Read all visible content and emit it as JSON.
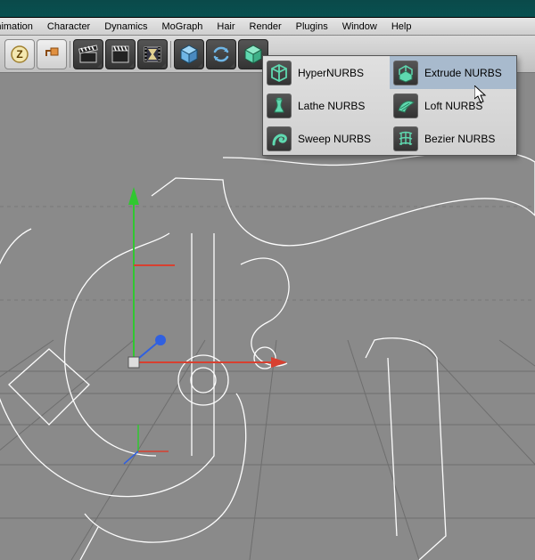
{
  "menu": {
    "items": [
      "Animation",
      "Character",
      "Dynamics",
      "MoGraph",
      "Hair",
      "Render",
      "Plugins",
      "Window",
      "Help"
    ]
  },
  "toolbar": {
    "buttons": [
      "undo",
      "redo",
      "clapper-1",
      "clapper-2",
      "render-film",
      "cube-primitive",
      "rotate-arrows",
      "nurbs-active"
    ]
  },
  "dropdown": {
    "items": [
      {
        "label": "HyperNURBS",
        "icon": "cube-wire",
        "hi": false
      },
      {
        "label": "Extrude NURBS",
        "icon": "extrude",
        "hi": true
      },
      {
        "label": "Lathe NURBS",
        "icon": "vase",
        "hi": false
      },
      {
        "label": "Loft NURBS",
        "icon": "wing",
        "hi": false
      },
      {
        "label": "Sweep NURBS",
        "icon": "swirl",
        "hi": false
      },
      {
        "label": "Bezier NURBS",
        "icon": "grid-curve",
        "hi": false
      }
    ]
  },
  "colors": {
    "nurbs_green": "#5fd9b0",
    "axis_x": "#d84030",
    "axis_y": "#30c830",
    "axis_z": "#3060e0"
  }
}
